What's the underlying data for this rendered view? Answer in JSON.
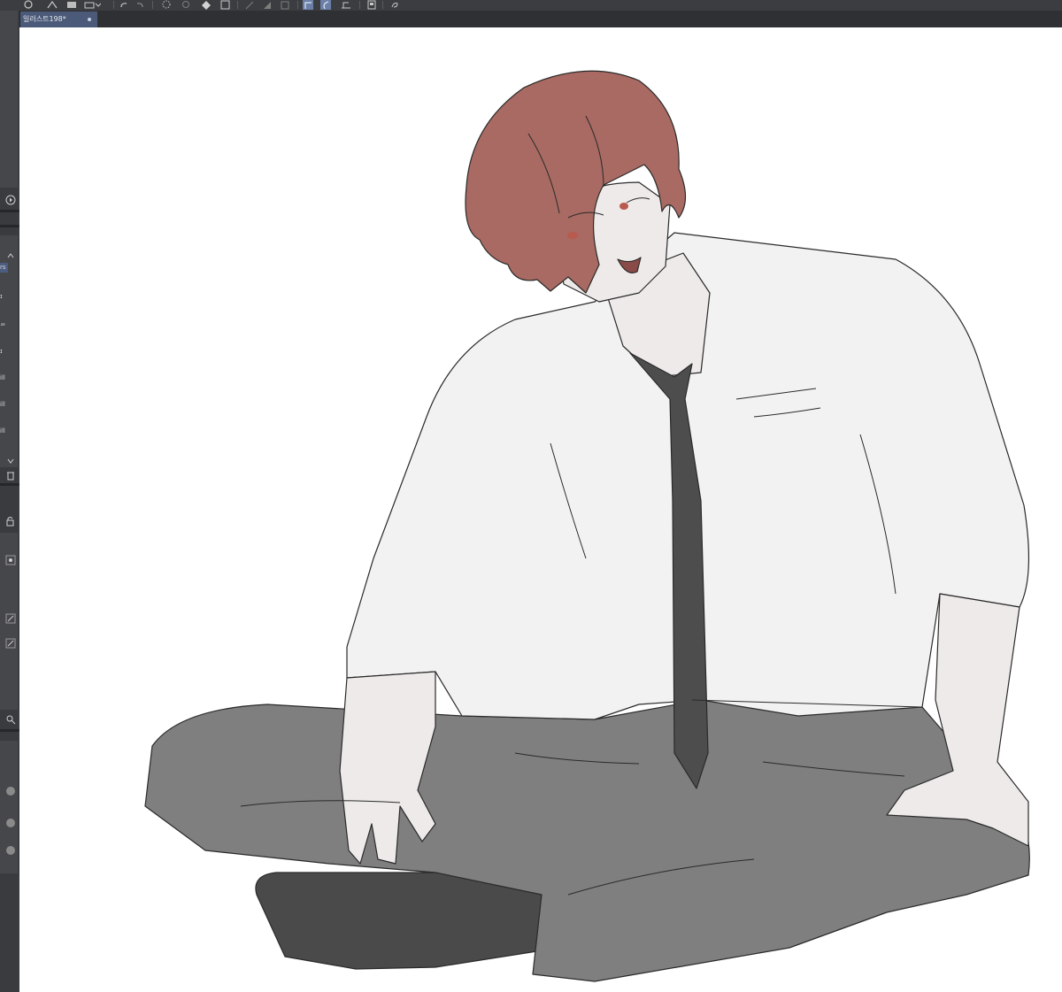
{
  "app": {
    "document_tab": {
      "title": "일러스트198*"
    }
  },
  "left_panel": {
    "layer_items": [
      {
        "label": "rs"
      },
      {
        "label": "ɪ"
      },
      {
        "label": "ᆯ"
      },
      {
        "label": "ɪ"
      },
      {
        "label": "ill"
      },
      {
        "label": "ill"
      },
      {
        "label": "ill"
      }
    ]
  },
  "colors": {
    "toolbar_bg": "#3c3d40",
    "panel_bg": "#3a3b3e",
    "active_tab": "#4b5a78",
    "canvas_bg": "#ffffff",
    "hair": "#a86a62",
    "skin": "#eeeaea",
    "shirt": "#f2f2f2",
    "tie": "#4d4d4d",
    "pants": "#7f7f7f",
    "socks": "#4a4a4a"
  },
  "icons": [
    "layer-icon",
    "move-icon",
    "transform-icon",
    "undo-icon",
    "redo-icon",
    "loading-icon",
    "settings-icon",
    "fill-icon",
    "select-icon",
    "ruler-icon",
    "curve-icon",
    "line-icon",
    "file-icon",
    "more-icon"
  ]
}
